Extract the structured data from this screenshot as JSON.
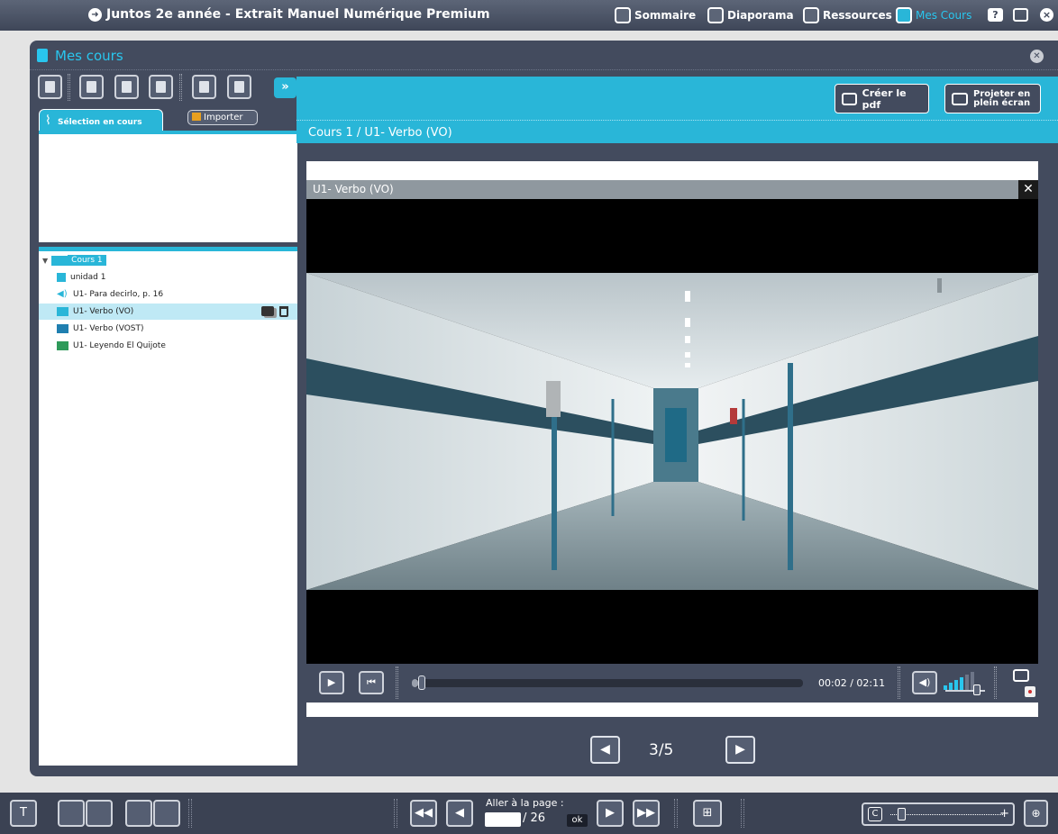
{
  "app": {
    "title": "Juntos 2e année - Extrait Manuel Numérique Premium",
    "nav": {
      "sommaire": "Sommaire",
      "diaporama": "Diaporama",
      "ressources": "Ressources",
      "mes_cours": "Mes Cours"
    },
    "help_label": "?",
    "close_label": "×"
  },
  "panel": {
    "title": "Mes cours",
    "expand_label": "»",
    "tab_selection": "Sélection en cours",
    "importer": "Importer",
    "breadcrumb": "Cours 1 / U1- Verbo (VO)",
    "create_pdf": "Créer le pdf",
    "project_line1": "Projeter en",
    "project_line2": "plein écran",
    "tree": {
      "root": "Cours 1",
      "items": [
        {
          "label": "unidad 1"
        },
        {
          "label": "U1- Para decirlo, p. 16"
        },
        {
          "label": "U1- Verbo (VO)"
        },
        {
          "label": "U1- Verbo (VOST)"
        },
        {
          "label": "U1- Leyendo El Quijote"
        }
      ]
    }
  },
  "video": {
    "title": "U1- Verbo (VO)",
    "close_label": "✕",
    "time": "00:02  / 02:11",
    "progress": 0.015,
    "volume_level": 0.7
  },
  "pager": {
    "label": "3/5"
  },
  "bottom": {
    "goto_label": "Aller à la page :",
    "total_pages": "/ 26",
    "ok": "ok"
  },
  "colors": {
    "accent": "#29b6d8",
    "panel": "#434b5e",
    "topbar": "#4a5266"
  }
}
